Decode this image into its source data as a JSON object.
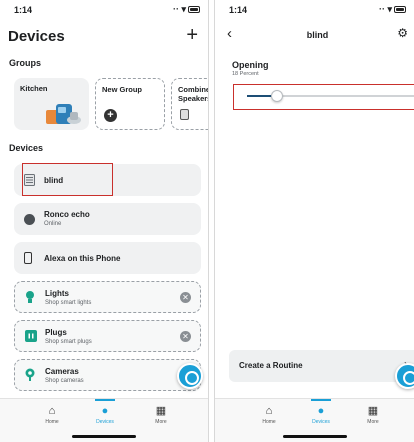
{
  "left_screen": {
    "status_time": "1:14",
    "title": "Devices",
    "add_label": "+",
    "groups_heading": "Groups",
    "groups": [
      {
        "label": "Kitchen"
      },
      {
        "label": "New Group"
      },
      {
        "label": "Combine Speakers"
      }
    ],
    "devices_heading": "Devices",
    "devices": [
      {
        "name": "blind",
        "sub": ""
      },
      {
        "name": "Ronco echo",
        "sub": "Online"
      },
      {
        "name": "Alexa on this Phone",
        "sub": ""
      }
    ],
    "suggestions": [
      {
        "name": "Lights",
        "sub": "Shop smart lights"
      },
      {
        "name": "Plugs",
        "sub": "Shop smart plugs"
      },
      {
        "name": "Cameras",
        "sub": "Shop cameras"
      }
    ],
    "tabs": [
      {
        "label": "Home",
        "icon": "home-icon"
      },
      {
        "label": "Devices",
        "icon": "bulb-icon",
        "active": true
      },
      {
        "label": "More",
        "icon": "grid-icon"
      }
    ]
  },
  "right_screen": {
    "status_time": "1:14",
    "title": "blind",
    "opening_label": "Opening",
    "opening_value_text": "18 Percent",
    "opening_percent": 18,
    "routine_label": "Create a Routine",
    "tabs": [
      {
        "label": "Home",
        "icon": "home-icon"
      },
      {
        "label": "Devices",
        "icon": "bulb-icon",
        "active": true
      },
      {
        "label": "More",
        "icon": "grid-icon"
      }
    ]
  },
  "colors": {
    "accent": "#1a9fd6",
    "highlight": "#c9302c",
    "card": "#f0f1f2",
    "slider_fill": "#1d4e75"
  }
}
